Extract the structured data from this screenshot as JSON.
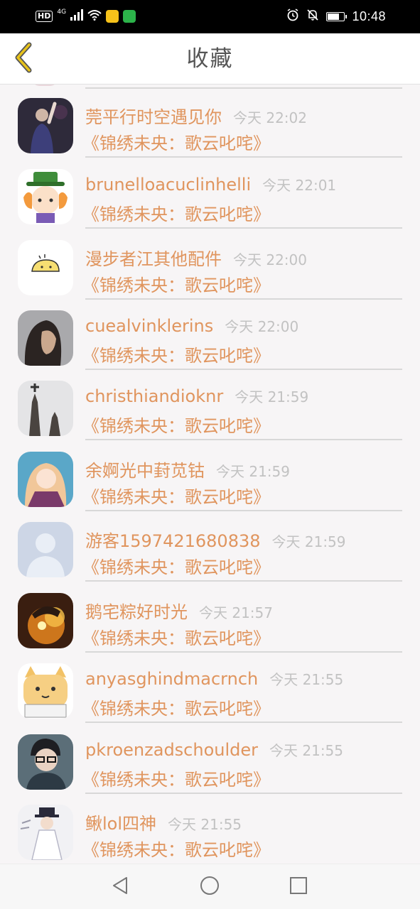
{
  "status_bar": {
    "hd_label": "HD",
    "network_label": "4G",
    "time": "10:48",
    "battery_level": 0.8
  },
  "header": {
    "title": "收藏",
    "back_icon": "chevron-left-icon",
    "accent_color": "#e7c21a"
  },
  "colors": {
    "name_color": "#e0955e",
    "time_color": "#c2c2c2",
    "divider_color": "#d8d8d8"
  },
  "favorites": [
    {
      "name": "莞平行时空遇见你",
      "time": "今天 22:02",
      "book": "《锦绣未央：歌云叱咤》"
    },
    {
      "name": "brunelloacuclinhelli",
      "time": "今天 22:01",
      "book": "《锦绣未央：歌云叱咤》"
    },
    {
      "name": "漫步者江其他配件",
      "time": "今天 22:00",
      "book": "《锦绣未央：歌云叱咤》"
    },
    {
      "name": "cuealvinklerins",
      "time": "今天 22:00",
      "book": "《锦绣未央：歌云叱咤》"
    },
    {
      "name": "christhiandioknr",
      "time": "今天 21:59",
      "book": "《锦绣未央：歌云叱咤》"
    },
    {
      "name": "余婀光中葑苋钴",
      "time": "今天 21:59",
      "book": "《锦绣未央：歌云叱咤》"
    },
    {
      "name": "游客1597421680838",
      "time": "今天 21:59",
      "book": "《锦绣未央：歌云叱咤》"
    },
    {
      "name": "鹅宅粽好时光",
      "time": "今天 21:57",
      "book": "《锦绣未央：歌云叱咤》"
    },
    {
      "name": "anyasghindmacrnch",
      "time": "今天 21:55",
      "book": "《锦绣未央：歌云叱咤》"
    },
    {
      "name": "pkroenzadschoulder",
      "time": "今天 21:55",
      "book": "《锦绣未央：歌云叱咤》"
    },
    {
      "name": "鳅lol四神",
      "time": "今天 21:55",
      "book": "《锦绣未央：歌云叱咤》"
    }
  ],
  "nav": {
    "back_icon": "triangle-back-icon",
    "home_icon": "circle-home-icon",
    "recents_icon": "square-recents-icon"
  }
}
